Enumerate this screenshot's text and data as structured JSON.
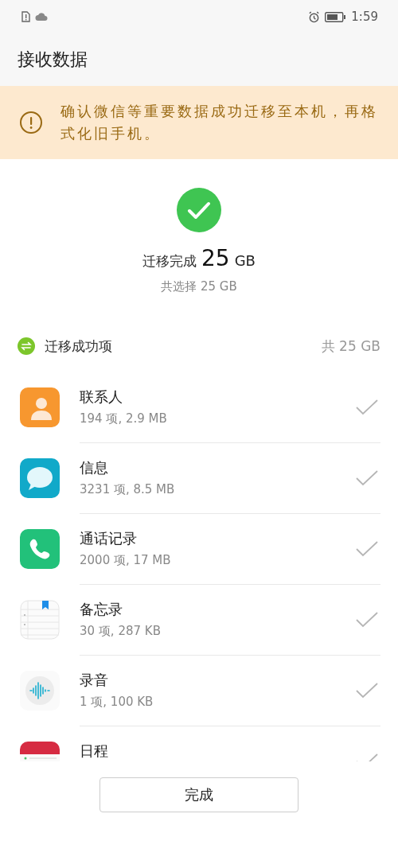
{
  "status_bar": {
    "time": "1:59"
  },
  "header": {
    "title": "接收数据"
  },
  "notice": {
    "text": "确认微信等重要数据成功迁移至本机，再格式化旧手机。"
  },
  "summary": {
    "label": "迁移完成",
    "amount": "25",
    "unit": "GB",
    "selected": "共选择 25 GB"
  },
  "section": {
    "title": "迁移成功项",
    "total": "共 25 GB"
  },
  "items": [
    {
      "kind": "contacts",
      "title": "联系人",
      "detail": "194 项, 2.9 MB",
      "done": true
    },
    {
      "kind": "messages",
      "title": "信息",
      "detail": "3231 项, 8.5 MB",
      "done": true
    },
    {
      "kind": "calls",
      "title": "通话记录",
      "detail": "2000 项, 17 MB",
      "done": true
    },
    {
      "kind": "notes",
      "title": "备忘录",
      "detail": "30 项, 287 KB",
      "done": true
    },
    {
      "kind": "recorder",
      "title": "录音",
      "detail": "1 项, 100 KB",
      "done": true
    },
    {
      "kind": "calendar",
      "title": "日程",
      "done": true
    }
  ],
  "button": {
    "label": "完成"
  }
}
